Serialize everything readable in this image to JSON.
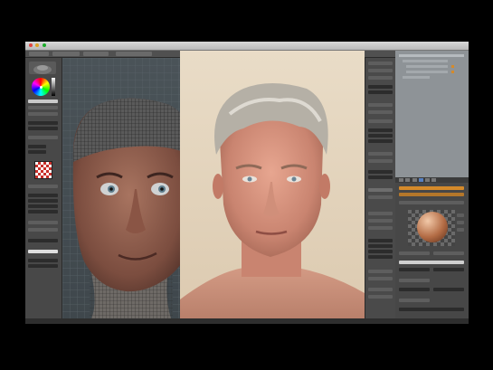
{
  "window": {
    "title": "",
    "controls": [
      {
        "name": "close",
        "color": "#e0443e"
      },
      {
        "name": "minimize",
        "color": "#dea123"
      },
      {
        "name": "maximize",
        "color": "#1aab29"
      }
    ]
  },
  "viewport": {
    "label": "",
    "shading": "wireframe-over-clay",
    "content": "3d-head-sculpt"
  },
  "reference_photo": {
    "content": "portrait-reference"
  },
  "colors": {
    "ui_dark": "#3a3a3a",
    "panel": "#474747",
    "outliner_bg": "#8e9397",
    "accent_orange": "#d58a2a",
    "selection_blue": "#5680c2",
    "viewport_bg": "#4a5358"
  },
  "material_preview": {
    "type": "sphere",
    "background": "checker"
  },
  "texture_preview": {
    "type": "checker-red-white"
  },
  "icons": [
    "color-wheel-icon",
    "brush-icon",
    "texture-checker-icon",
    "material-sphere-icon"
  ]
}
